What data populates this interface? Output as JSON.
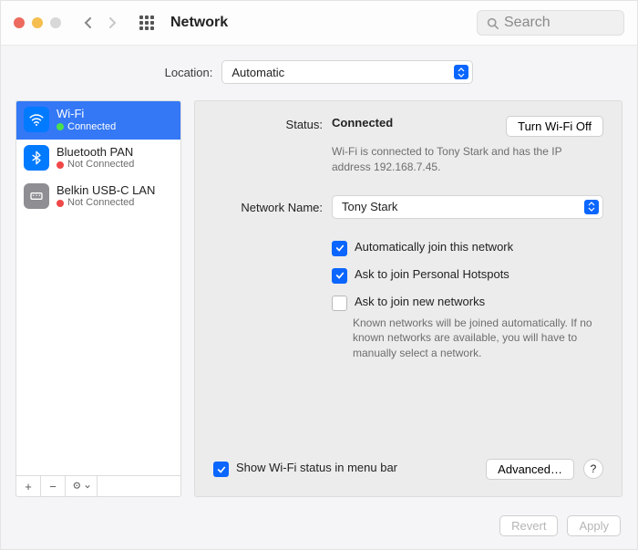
{
  "title": "Network",
  "search_placeholder": "Search",
  "location": {
    "label": "Location:",
    "value": "Automatic"
  },
  "sidebar": {
    "items": [
      {
        "name": "Wi-Fi",
        "status": "Connected",
        "color": "green",
        "selected": true,
        "icon": "wifi"
      },
      {
        "name": "Bluetooth PAN",
        "status": "Not Connected",
        "color": "red",
        "selected": false,
        "icon": "bt"
      },
      {
        "name": "Belkin USB-C LAN",
        "status": "Not Connected",
        "color": "red",
        "selected": false,
        "icon": "eth"
      }
    ]
  },
  "detail": {
    "status_label": "Status:",
    "status_value": "Connected",
    "toggle_label": "Turn Wi-Fi Off",
    "status_note": "Wi-Fi is connected to Tony Stark and has the IP address 192.168.7.45.",
    "network_name_label": "Network Name:",
    "network_name_value": "Tony Stark",
    "auto_join": "Automatically join this network",
    "ask_hotspot": "Ask to join Personal Hotspots",
    "ask_new": "Ask to join new networks",
    "ask_new_note": "Known networks will be joined automatically. If no known networks are available, you will have to manually select a network.",
    "show_menubar": "Show Wi-Fi status in menu bar",
    "advanced": "Advanced…"
  },
  "footer": {
    "revert": "Revert",
    "apply": "Apply"
  }
}
